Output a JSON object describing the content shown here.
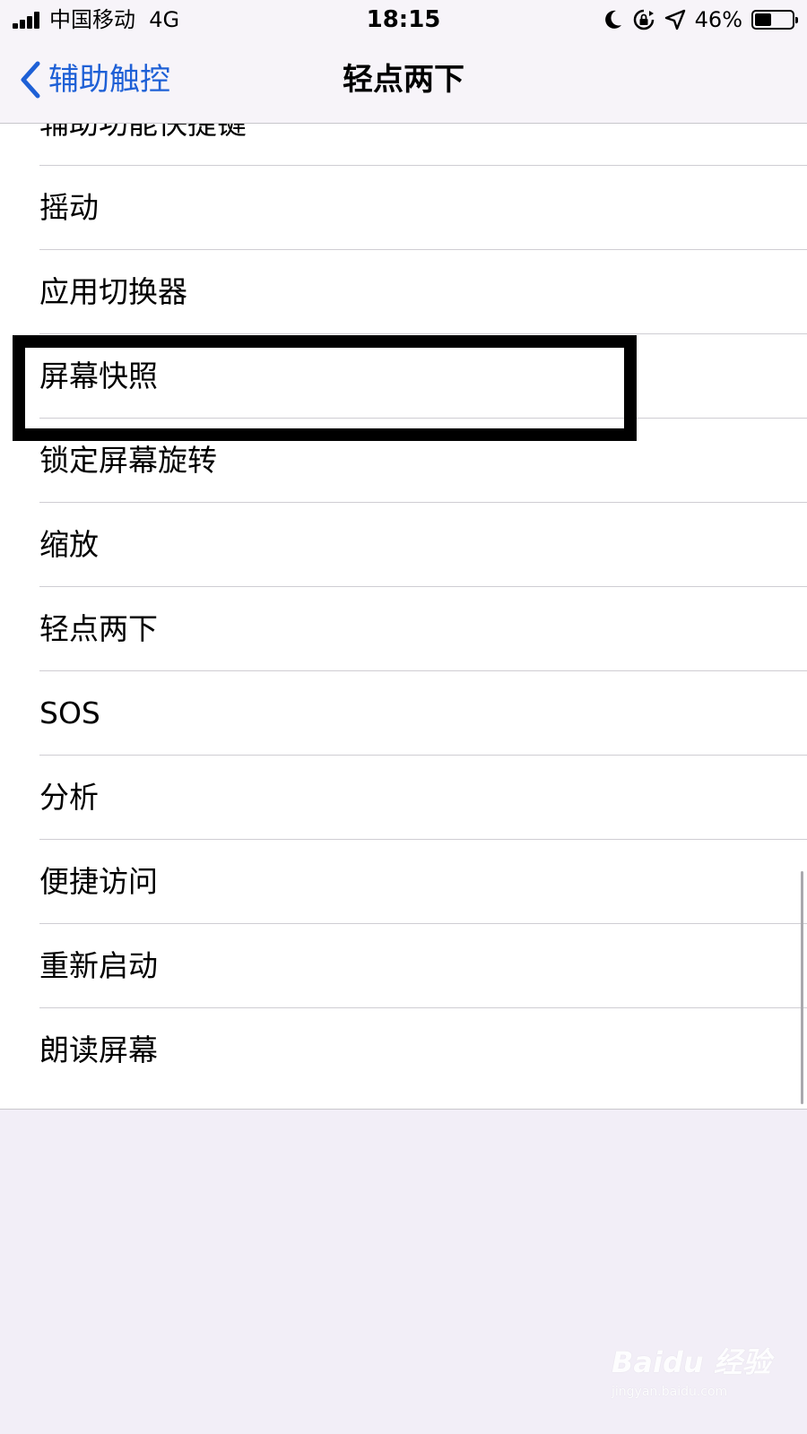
{
  "status_bar": {
    "carrier": "中国移动",
    "network": "4G",
    "time": "18:15",
    "battery_percent": "46%",
    "battery_level": 0.46,
    "icons": [
      "signal-icon",
      "moon-icon",
      "rotation-lock-icon",
      "location-icon",
      "battery-icon"
    ]
  },
  "nav": {
    "back_label": "辅助触控",
    "title": "轻点两下"
  },
  "list": {
    "items": [
      {
        "label": "辅助功能快捷键"
      },
      {
        "label": "摇动"
      },
      {
        "label": "应用切换器"
      },
      {
        "label": "屏幕快照"
      },
      {
        "label": "锁定屏幕旋转"
      },
      {
        "label": "缩放"
      },
      {
        "label": "轻点两下"
      },
      {
        "label": "SOS"
      },
      {
        "label": "分析"
      },
      {
        "label": "便捷访问"
      },
      {
        "label": "重新启动"
      },
      {
        "label": "朗读屏幕"
      }
    ]
  },
  "watermark": {
    "brand": "Baidu 经验",
    "url": "jingyan.baidu.com"
  },
  "colors": {
    "accent": "#1e60d6",
    "background": "#f2eef7",
    "list_background": "#ffffff",
    "separator": "#cfcdd3",
    "highlight": "#000000"
  }
}
